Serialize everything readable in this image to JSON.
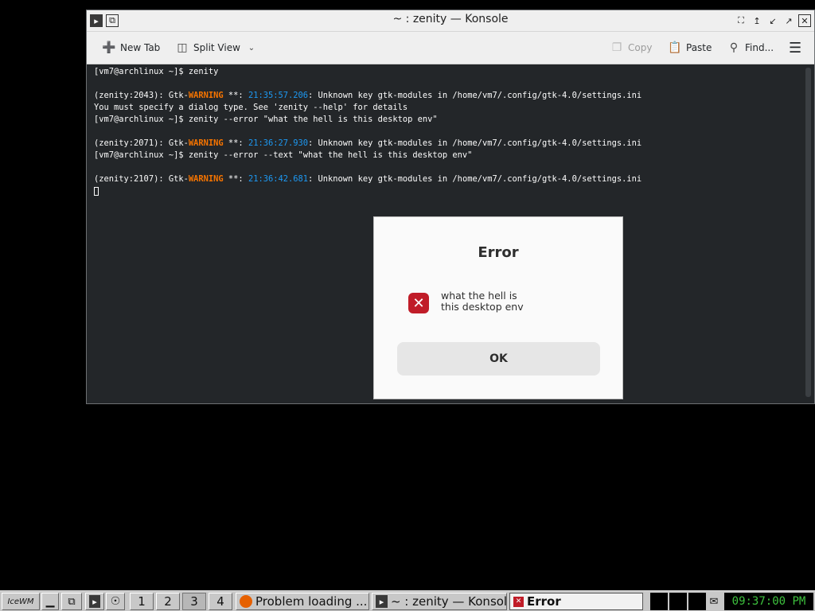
{
  "konsole": {
    "title": "~ : zenity — Konsole",
    "toolbar": {
      "new_tab": "New Tab",
      "split_view": "Split View",
      "copy": "Copy",
      "paste": "Paste",
      "find": "Find..."
    },
    "terminal": {
      "lines": [
        {
          "prompt": "[vm7@archlinux ~]$ ",
          "cmd": "zenity"
        },
        {
          "pre": "(zenity:2043): Gtk-",
          "warn": "WARNING",
          "mid": " **: ",
          "time": "21:35:57.206",
          "post": ": Unknown key gtk-modules in /home/vm7/.config/gtk-4.0/settings.ini"
        },
        {
          "text": "You must specify a dialog type. See 'zenity --help' for details"
        },
        {
          "prompt": "[vm7@archlinux ~]$ ",
          "cmd": "zenity --error \"what the hell is this desktop env\""
        },
        {
          "pre": "(zenity:2071): Gtk-",
          "warn": "WARNING",
          "mid": " **: ",
          "time": "21:36:27.930",
          "post": ": Unknown key gtk-modules in /home/vm7/.config/gtk-4.0/settings.ini"
        },
        {
          "prompt": "[vm7@archlinux ~]$ ",
          "cmd": "zenity --error --text \"what the hell is this desktop env\""
        },
        {
          "pre": "(zenity:2107): Gtk-",
          "warn": "WARNING",
          "mid": " **: ",
          "time": "21:36:42.681",
          "post": ": Unknown key gtk-modules in /home/vm7/.config/gtk-4.0/settings.ini"
        }
      ]
    }
  },
  "dialog": {
    "title": "Error",
    "message_line1": "what the hell is",
    "message_line2": "this desktop env",
    "ok_label": "OK"
  },
  "taskbar": {
    "logo_text": "IceWM",
    "workspaces": [
      "1",
      "2",
      "3",
      "4"
    ],
    "active_workspace": "3",
    "tasks": {
      "firefox": "Problem loading ...",
      "konsole": "~ : zenity — Konsole",
      "error": "Error"
    },
    "clock": "09:37:00 PM"
  },
  "colors": {
    "terminal_bg": "#232629",
    "warning": "#f67400",
    "timestamp": "#1d99f3",
    "error_icon": "#c01c28",
    "clock_text": "#3ec23e"
  }
}
